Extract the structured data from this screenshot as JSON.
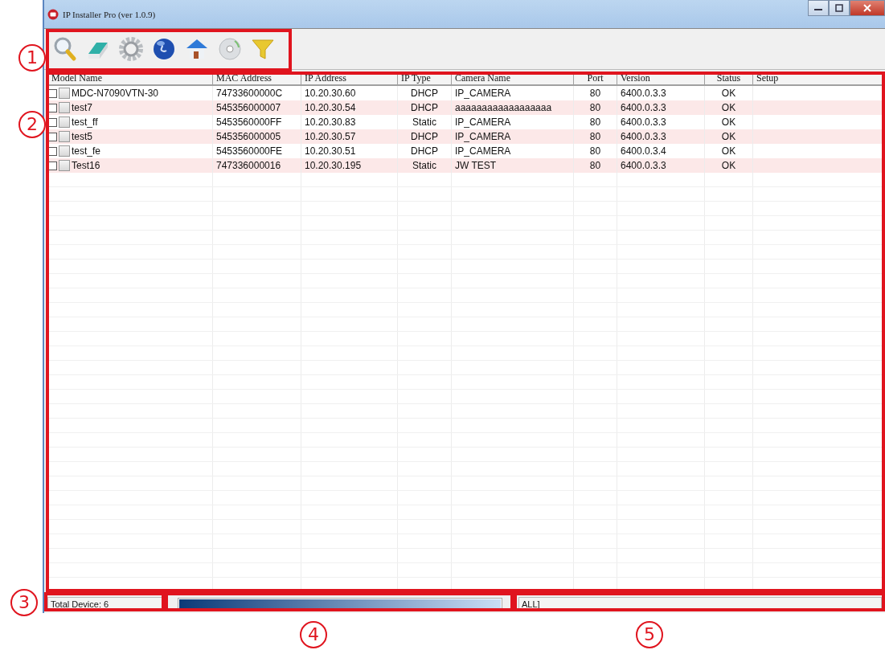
{
  "window": {
    "title": "IP Installer Pro (ver 1.0.9)"
  },
  "toolbar": [
    {
      "kind": "search"
    },
    {
      "kind": "eraser"
    },
    {
      "kind": "gear"
    },
    {
      "kind": "globe"
    },
    {
      "kind": "house"
    },
    {
      "kind": "disc"
    },
    {
      "kind": "funnel"
    }
  ],
  "table": {
    "columns": [
      "Model Name",
      "MAC Address",
      "IP Address",
      "IP Type",
      "Camera Name",
      "Port",
      "Version",
      "Status",
      "Setup"
    ],
    "rows": [
      {
        "checked": false,
        "cells": [
          "MDC-N7090VTN-30",
          "74733600000C",
          "10.20.30.60",
          "DHCP",
          "IP_CAMERA",
          "80",
          "6400.0.3.3",
          "OK"
        ]
      },
      {
        "checked": false,
        "cells": [
          "test7",
          "545356000007",
          "10.20.30.54",
          "DHCP",
          "aaaaaaaaaaaaaaaaaa",
          "80",
          "6400.0.3.3",
          "OK"
        ]
      },
      {
        "checked": false,
        "cells": [
          "test_ff",
          "5453560000FF",
          "10.20.30.83",
          "Static",
          "IP_CAMERA",
          "80",
          "6400.0.3.3",
          "OK"
        ]
      },
      {
        "checked": false,
        "cells": [
          "test5",
          "545356000005",
          "10.20.30.57",
          "DHCP",
          "IP_CAMERA",
          "80",
          "6400.0.3.3",
          "OK"
        ]
      },
      {
        "checked": false,
        "cells": [
          "test_fe",
          "5453560000FE",
          "10.20.30.51",
          "DHCP",
          "IP_CAMERA",
          "80",
          "6400.0.3.4",
          "OK"
        ]
      },
      {
        "checked": false,
        "cells": [
          "Test16",
          "747336000016",
          "10.20.30.195",
          "Static",
          "JW TEST",
          "80",
          "6400.0.3.3",
          "OK"
        ]
      }
    ]
  },
  "status_bar": {
    "device_count": "Total Device: 6",
    "progress": {
      "level": 1
    },
    "filter": "ALL]"
  },
  "callouts": [
    {
      "number": "1"
    },
    {
      "number": "2"
    },
    {
      "number": "3"
    },
    {
      "number": "4"
    },
    {
      "number": "5"
    }
  ]
}
